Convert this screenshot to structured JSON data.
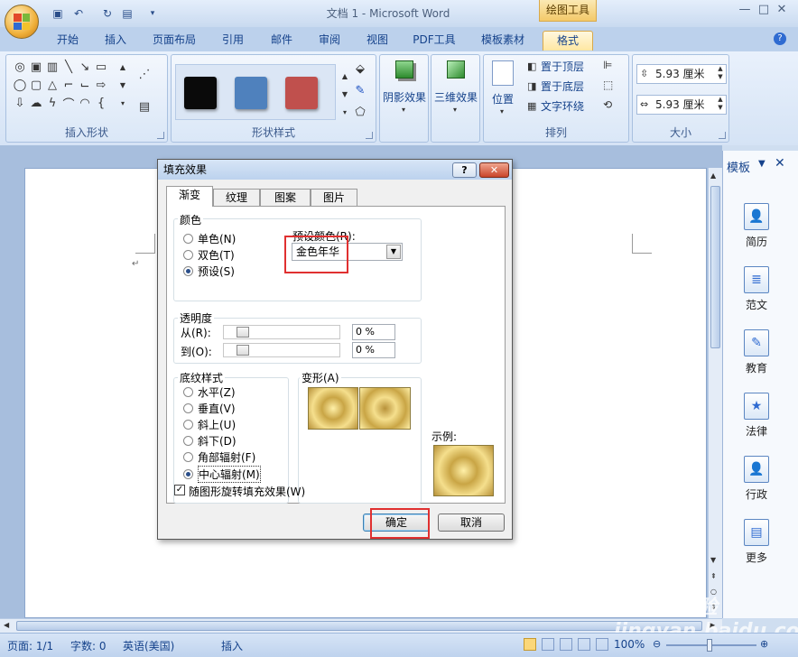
{
  "window": {
    "title": "文档 1 - Microsoft Word",
    "context_tab_group": "绘图工具",
    "controls": [
      "—",
      "□",
      "✕"
    ]
  },
  "quick_access": [
    "save-icon",
    "undo-icon",
    "redo-icon",
    "print-preview-icon"
  ],
  "tabs": [
    {
      "label": "开始"
    },
    {
      "label": "插入"
    },
    {
      "label": "页面布局"
    },
    {
      "label": "引用"
    },
    {
      "label": "邮件"
    },
    {
      "label": "审阅"
    },
    {
      "label": "视图"
    },
    {
      "label": "PDF工具"
    },
    {
      "label": "模板素材"
    },
    {
      "label": "格式",
      "active": true
    }
  ],
  "ribbon": {
    "groups": {
      "insert_shapes": "插入形状",
      "shape_styles": "形状样式",
      "shadow": "阴影效果",
      "threed": "三维效果",
      "arrange": "排列",
      "size": "大小"
    },
    "style_swatches": [
      "#0a0a0a",
      "#4f81bd",
      "#c0504d"
    ],
    "arrange_items": {
      "position": "位置",
      "bring_front": "置于顶层",
      "send_back": "置于底层",
      "text_wrap": "文字环绕"
    },
    "size": {
      "height": "5.93 厘米",
      "width": "5.93 厘米"
    }
  },
  "template_pane": {
    "title": "模板",
    "items": [
      "简历",
      "范文",
      "教育",
      "法律",
      "行政",
      "更多"
    ]
  },
  "status_bar": {
    "page": "页面: 1/1",
    "words": "字数: 0",
    "language": "英语(美国)",
    "mode": "插入",
    "zoom": "100%"
  },
  "watermark": "Baidu经验 jingyan.baidu.com",
  "dialog": {
    "title": "填充效果",
    "tabs": [
      {
        "label": "渐变",
        "active": true
      },
      {
        "label": "纹理"
      },
      {
        "label": "图案"
      },
      {
        "label": "图片"
      }
    ],
    "color_section": "颜色",
    "color_options": [
      {
        "label": "单色(N)",
        "selected": false
      },
      {
        "label": "双色(T)",
        "selected": false
      },
      {
        "label": "预设(S)",
        "selected": true
      }
    ],
    "preset_label": "预设颜色(R):",
    "preset_value": "金色年华",
    "transparency_section": "透明度",
    "from_label": "从(R):",
    "to_label": "到(O):",
    "from_value": "0 %",
    "to_value": "0 %",
    "shading_section": "底纹样式",
    "shading_options": [
      {
        "label": "水平(Z)",
        "selected": false
      },
      {
        "label": "垂直(V)",
        "selected": false
      },
      {
        "label": "斜上(U)",
        "selected": false
      },
      {
        "label": "斜下(D)",
        "selected": false
      },
      {
        "label": "角部辐射(F)",
        "selected": false
      },
      {
        "label": "中心辐射(M)",
        "selected": true
      }
    ],
    "variants_label": "变形(A)",
    "sample_label": "示例:",
    "rotate_checkbox": "随图形旋转填充效果(W)",
    "ok": "确定",
    "cancel": "取消",
    "help": "?",
    "close": "✕"
  }
}
